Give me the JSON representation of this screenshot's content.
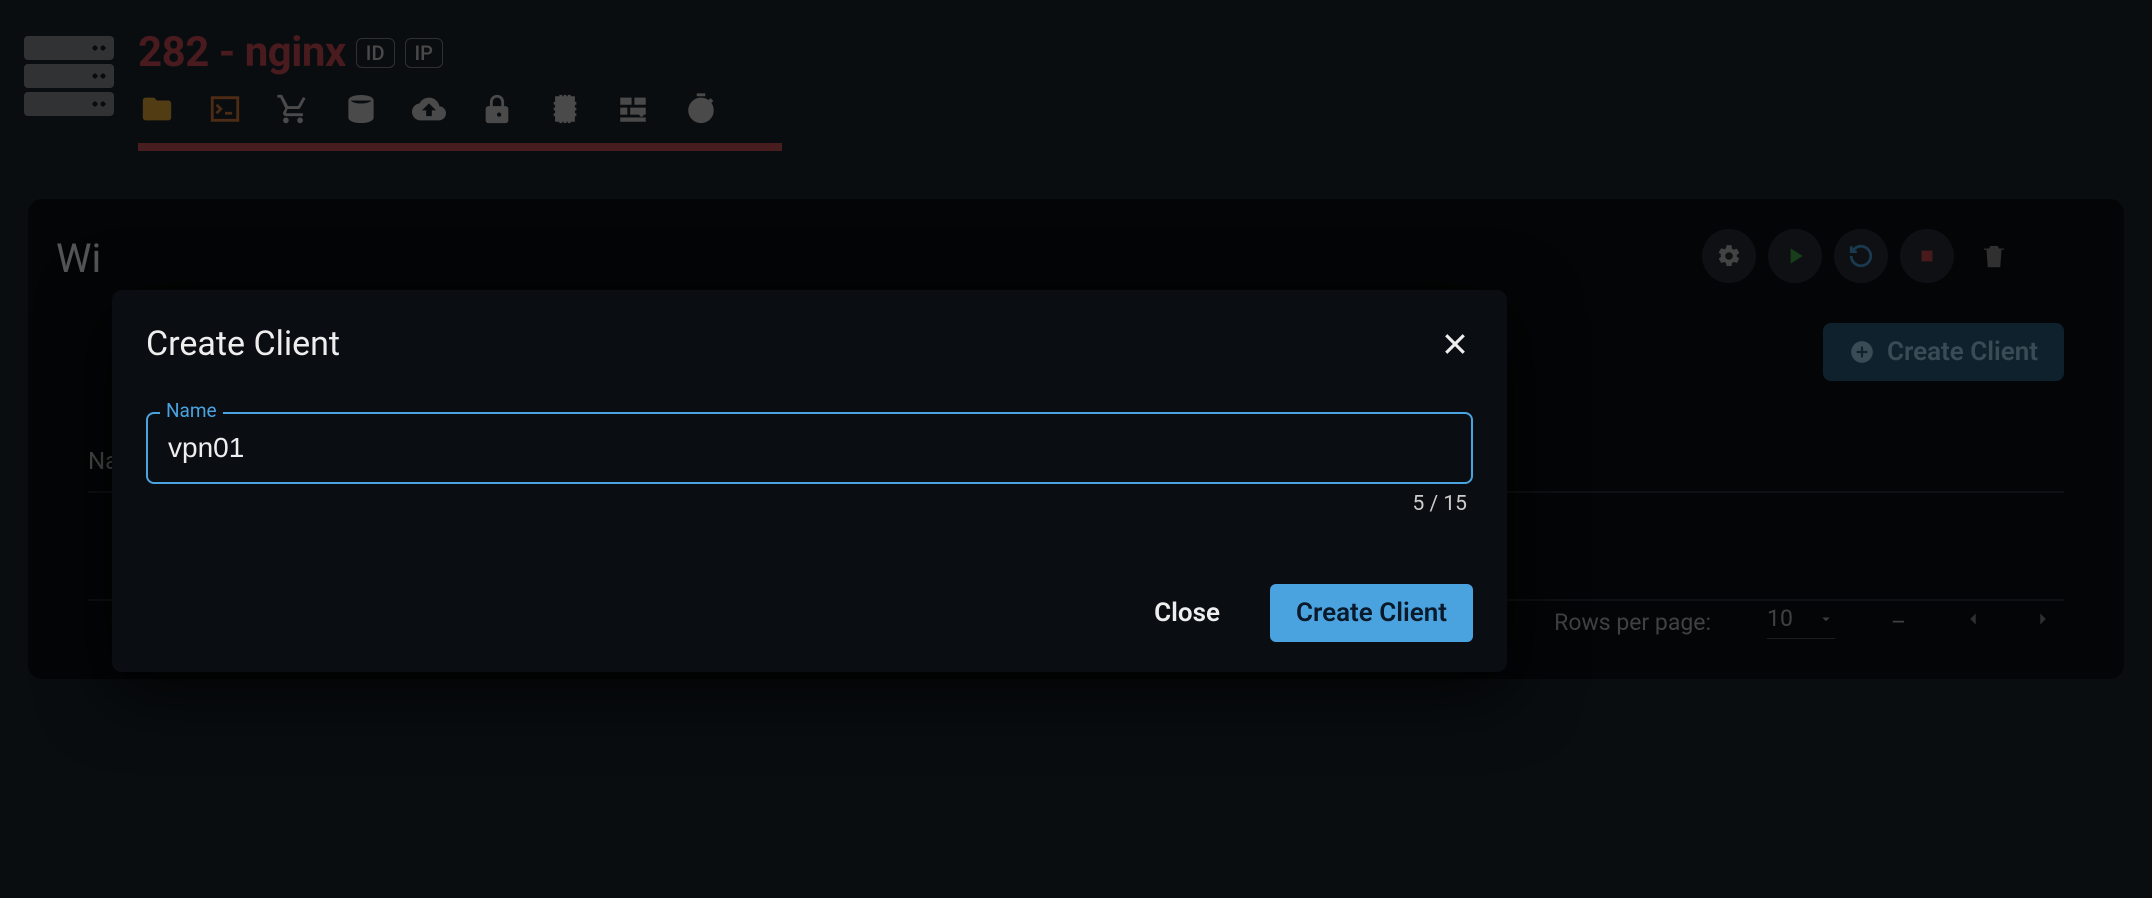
{
  "header": {
    "title": "282 - nginx",
    "chips": [
      "ID",
      "IP"
    ]
  },
  "panel": {
    "title_partial": "Wi",
    "create_button": "Create Client",
    "table_header": "Na",
    "pagination": {
      "label": "Rows per page:",
      "value": "10",
      "range": "–"
    }
  },
  "modal": {
    "title": "Create Client",
    "field_label": "Name",
    "field_value": "vpn01",
    "counter": "5 / 15",
    "close_label": "Close",
    "submit_label": "Create Client"
  }
}
